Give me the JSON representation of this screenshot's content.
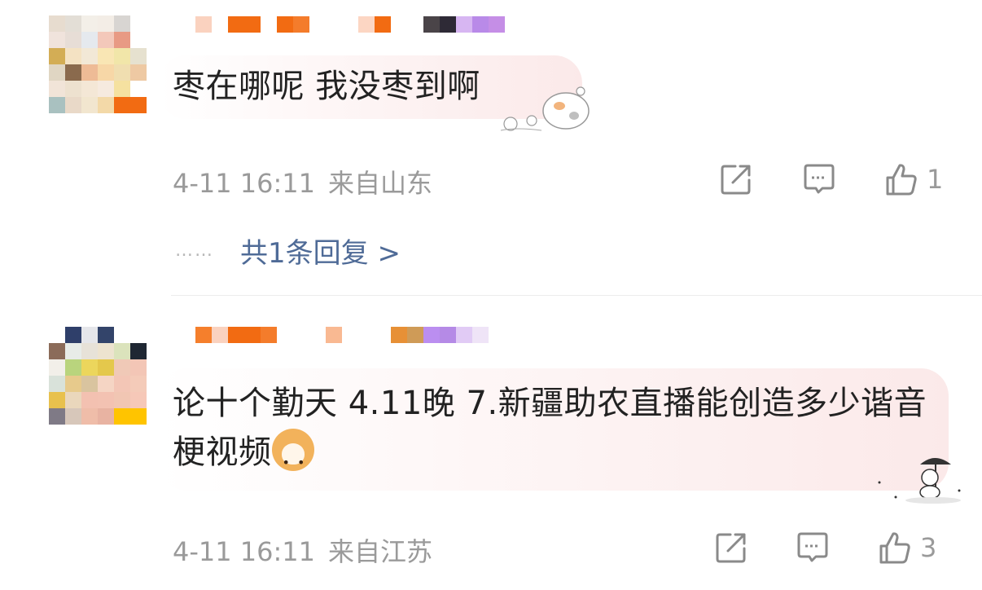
{
  "comments": [
    {
      "text": "枣在哪呢 我没枣到啊",
      "time": "4-11 16:11",
      "location": "来自山东",
      "likes": "1",
      "reply_summary": "共1条回复 >",
      "reply_dots": "……",
      "avatar_pixels": [
        "#e7dccf",
        "#e3ded6",
        "#f3efe8",
        "#f3ede6",
        "#d8d5d2",
        "#ffffff",
        "#f0e3dc",
        "#e7ddd6",
        "#e5e9ee",
        "#f3c8ba",
        "#e89a84",
        "#ffffff",
        "#d3ad55",
        "#f4e2c3",
        "#f2e8d6",
        "#f9e6b4",
        "#f1e6a9",
        "#e6e1cf",
        "#e0d6c3",
        "#8a6a4d",
        "#eebb96",
        "#f7d7a7",
        "#f0deb0",
        "#eec9a3",
        "#f1e4d8",
        "#ede1cf",
        "#f4e7d6",
        "#f6eadf",
        "#f5e1a0",
        "#ffffff",
        "#a9c1c0",
        "#e9d9c8",
        "#f2e6cf",
        "#f3d9a8",
        "#f26b12",
        "#f26b12"
      ],
      "name_pixels": [
        "#ffffff",
        "#fad2bf",
        "#ffffff",
        "#f26b12",
        "#f26b12",
        "#ffffff",
        "#f26b12",
        "#f47c2b",
        "#ffffff",
        "#ffffff",
        "#ffffff",
        "#fcd6c3",
        "#f26b12",
        "#ffffff",
        "#ffffff",
        "#4a4448",
        "#2e2a36",
        "#d7b6f2",
        "#b98ae8",
        "#c58ee6"
      ]
    },
    {
      "text": "论十个勤天 4.11晚 7.新疆助农直播能创造多少谐音梗视频",
      "time": "4-11 16:11",
      "location": "来自江苏",
      "likes": "3",
      "avatar_pixels": [
        "#ffffff",
        "#2f3f6a",
        "#e5e6ea",
        "#33446a",
        "#ffffff",
        "#ffffff",
        "#8b6b59",
        "#e8ece8",
        "#e7e2d8",
        "#ede3cf",
        "#dbe3bc",
        "#1f2733",
        "#f2efe9",
        "#b9d47d",
        "#ecd65c",
        "#e4c84c",
        "#f0c9b7",
        "#f3c6b6",
        "#d9e2da",
        "#e7ca8c",
        "#d9c49f",
        "#f5d5c4",
        "#f3c6b6",
        "#f4cbb9",
        "#e8c14d",
        "#ead7bc",
        "#f3c1b1",
        "#f3c2b2",
        "#f1c6b3",
        "#f6c8b8",
        "#7f7a86",
        "#d7c7ba",
        "#efbda9",
        "#e8b3a2",
        "#ffc400",
        "#ffc400"
      ],
      "name_pixels": [
        "#ffffff",
        "#f57f2c",
        "#fad2bf",
        "#f26b12",
        "#f26b12",
        "#f47c2b",
        "#ffffff",
        "#ffffff",
        "#ffffff",
        "#f9b992",
        "#ffffff",
        "#ffffff",
        "#ffffff",
        "#e79036",
        "#cf9b57",
        "#bb8ef0",
        "#b58ae6",
        "#e1cbf5",
        "#efe4f7",
        "#ffffff"
      ]
    }
  ],
  "icons": [
    "share-icon",
    "comment-icon",
    "thumbs-up-icon",
    "dog-emoji-icon"
  ],
  "colors": {
    "text": "#222222",
    "meta": "#9a9a9a",
    "reply_link": "#4f6b97",
    "username_accent": "#f26b12"
  }
}
